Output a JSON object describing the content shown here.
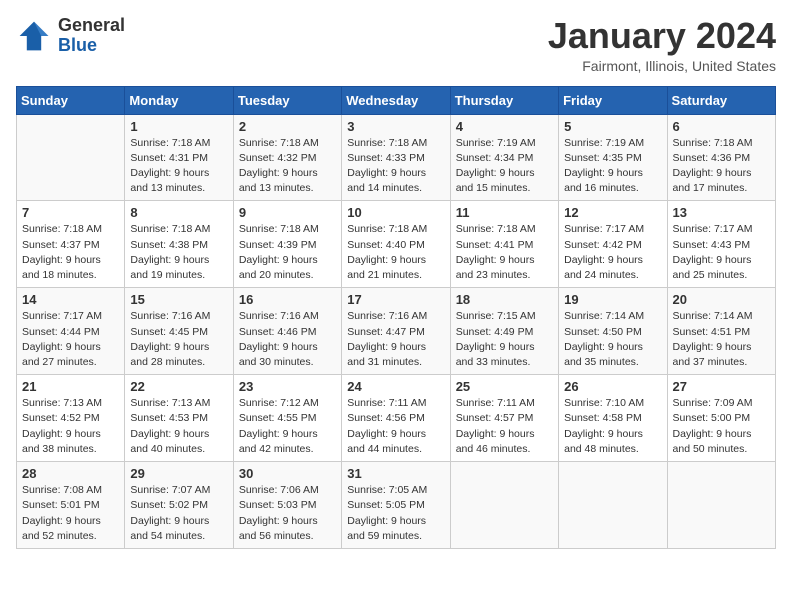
{
  "logo": {
    "text_general": "General",
    "text_blue": "Blue"
  },
  "title": "January 2024",
  "subtitle": "Fairmont, Illinois, United States",
  "days_of_week": [
    "Sunday",
    "Monday",
    "Tuesday",
    "Wednesday",
    "Thursday",
    "Friday",
    "Saturday"
  ],
  "weeks": [
    [
      {
        "num": "",
        "info": ""
      },
      {
        "num": "1",
        "info": "Sunrise: 7:18 AM\nSunset: 4:31 PM\nDaylight: 9 hours\nand 13 minutes."
      },
      {
        "num": "2",
        "info": "Sunrise: 7:18 AM\nSunset: 4:32 PM\nDaylight: 9 hours\nand 13 minutes."
      },
      {
        "num": "3",
        "info": "Sunrise: 7:18 AM\nSunset: 4:33 PM\nDaylight: 9 hours\nand 14 minutes."
      },
      {
        "num": "4",
        "info": "Sunrise: 7:19 AM\nSunset: 4:34 PM\nDaylight: 9 hours\nand 15 minutes."
      },
      {
        "num": "5",
        "info": "Sunrise: 7:19 AM\nSunset: 4:35 PM\nDaylight: 9 hours\nand 16 minutes."
      },
      {
        "num": "6",
        "info": "Sunrise: 7:18 AM\nSunset: 4:36 PM\nDaylight: 9 hours\nand 17 minutes."
      }
    ],
    [
      {
        "num": "7",
        "info": "Sunrise: 7:18 AM\nSunset: 4:37 PM\nDaylight: 9 hours\nand 18 minutes."
      },
      {
        "num": "8",
        "info": "Sunrise: 7:18 AM\nSunset: 4:38 PM\nDaylight: 9 hours\nand 19 minutes."
      },
      {
        "num": "9",
        "info": "Sunrise: 7:18 AM\nSunset: 4:39 PM\nDaylight: 9 hours\nand 20 minutes."
      },
      {
        "num": "10",
        "info": "Sunrise: 7:18 AM\nSunset: 4:40 PM\nDaylight: 9 hours\nand 21 minutes."
      },
      {
        "num": "11",
        "info": "Sunrise: 7:18 AM\nSunset: 4:41 PM\nDaylight: 9 hours\nand 23 minutes."
      },
      {
        "num": "12",
        "info": "Sunrise: 7:17 AM\nSunset: 4:42 PM\nDaylight: 9 hours\nand 24 minutes."
      },
      {
        "num": "13",
        "info": "Sunrise: 7:17 AM\nSunset: 4:43 PM\nDaylight: 9 hours\nand 25 minutes."
      }
    ],
    [
      {
        "num": "14",
        "info": "Sunrise: 7:17 AM\nSunset: 4:44 PM\nDaylight: 9 hours\nand 27 minutes."
      },
      {
        "num": "15",
        "info": "Sunrise: 7:16 AM\nSunset: 4:45 PM\nDaylight: 9 hours\nand 28 minutes."
      },
      {
        "num": "16",
        "info": "Sunrise: 7:16 AM\nSunset: 4:46 PM\nDaylight: 9 hours\nand 30 minutes."
      },
      {
        "num": "17",
        "info": "Sunrise: 7:16 AM\nSunset: 4:47 PM\nDaylight: 9 hours\nand 31 minutes."
      },
      {
        "num": "18",
        "info": "Sunrise: 7:15 AM\nSunset: 4:49 PM\nDaylight: 9 hours\nand 33 minutes."
      },
      {
        "num": "19",
        "info": "Sunrise: 7:14 AM\nSunset: 4:50 PM\nDaylight: 9 hours\nand 35 minutes."
      },
      {
        "num": "20",
        "info": "Sunrise: 7:14 AM\nSunset: 4:51 PM\nDaylight: 9 hours\nand 37 minutes."
      }
    ],
    [
      {
        "num": "21",
        "info": "Sunrise: 7:13 AM\nSunset: 4:52 PM\nDaylight: 9 hours\nand 38 minutes."
      },
      {
        "num": "22",
        "info": "Sunrise: 7:13 AM\nSunset: 4:53 PM\nDaylight: 9 hours\nand 40 minutes."
      },
      {
        "num": "23",
        "info": "Sunrise: 7:12 AM\nSunset: 4:55 PM\nDaylight: 9 hours\nand 42 minutes."
      },
      {
        "num": "24",
        "info": "Sunrise: 7:11 AM\nSunset: 4:56 PM\nDaylight: 9 hours\nand 44 minutes."
      },
      {
        "num": "25",
        "info": "Sunrise: 7:11 AM\nSunset: 4:57 PM\nDaylight: 9 hours\nand 46 minutes."
      },
      {
        "num": "26",
        "info": "Sunrise: 7:10 AM\nSunset: 4:58 PM\nDaylight: 9 hours\nand 48 minutes."
      },
      {
        "num": "27",
        "info": "Sunrise: 7:09 AM\nSunset: 5:00 PM\nDaylight: 9 hours\nand 50 minutes."
      }
    ],
    [
      {
        "num": "28",
        "info": "Sunrise: 7:08 AM\nSunset: 5:01 PM\nDaylight: 9 hours\nand 52 minutes."
      },
      {
        "num": "29",
        "info": "Sunrise: 7:07 AM\nSunset: 5:02 PM\nDaylight: 9 hours\nand 54 minutes."
      },
      {
        "num": "30",
        "info": "Sunrise: 7:06 AM\nSunset: 5:03 PM\nDaylight: 9 hours\nand 56 minutes."
      },
      {
        "num": "31",
        "info": "Sunrise: 7:05 AM\nSunset: 5:05 PM\nDaylight: 9 hours\nand 59 minutes."
      },
      {
        "num": "",
        "info": ""
      },
      {
        "num": "",
        "info": ""
      },
      {
        "num": "",
        "info": ""
      }
    ]
  ]
}
